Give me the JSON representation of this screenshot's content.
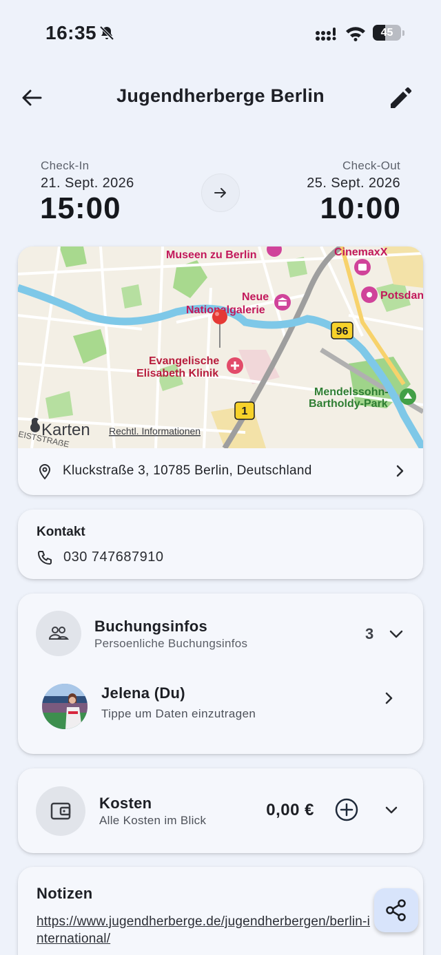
{
  "status_bar": {
    "time": "16:35",
    "battery_level": "45",
    "battery_fraction": 0.45
  },
  "header": {
    "title": "Jugendherberge Berlin",
    "back_icon": "arrow-left-icon",
    "edit_icon": "pencil-icon"
  },
  "check_in": {
    "label": "Check-In",
    "date": "21. Sept. 2026",
    "time": "15:00"
  },
  "check_out": {
    "label": "Check-Out",
    "date": "25. Sept. 2026",
    "time": "10:00"
  },
  "map": {
    "provider": "Karten",
    "legal": "Rechtl. Informationen",
    "labels": {
      "museum": "Museen zu Berlin",
      "cinema": "CinemaxX",
      "gallery_1": "Neue",
      "gallery_2": "Nationalgalerie",
      "potsdam": "Potsdan",
      "route_96": "96",
      "hospital_1": "Evangelische",
      "hospital_2": "Elisabeth Klinik",
      "park_1": "Mendelssohn-",
      "park_2": "Bartholdy-Park",
      "route_1": "1",
      "street": "EISTSTRAẞE"
    }
  },
  "address": {
    "text": "Kluckstraße 3, 10785 Berlin, Deutschland"
  },
  "contact": {
    "label": "Kontakt",
    "phone": "030 747687910"
  },
  "booking": {
    "title": "Buchungsinfos",
    "subtitle": "Persoenliche Buchungsinfos",
    "count": "3",
    "person": {
      "name": "Jelena (Du)",
      "hint": "Tippe um Daten einzutragen"
    }
  },
  "costs": {
    "title": "Kosten",
    "subtitle": "Alle Kosten im Blick",
    "amount": "0,00 €"
  },
  "notes": {
    "title": "Notizen",
    "link": "https://www.jugendherberge.de/jugendherbergen/berlin-international/"
  },
  "colors": {
    "background": "#eef2fa",
    "card": "#f5f7fc",
    "fab": "#d8e4fb",
    "map_pin": "#e53935",
    "map_label": "#c2185b",
    "park_label": "#2e7d32"
  }
}
